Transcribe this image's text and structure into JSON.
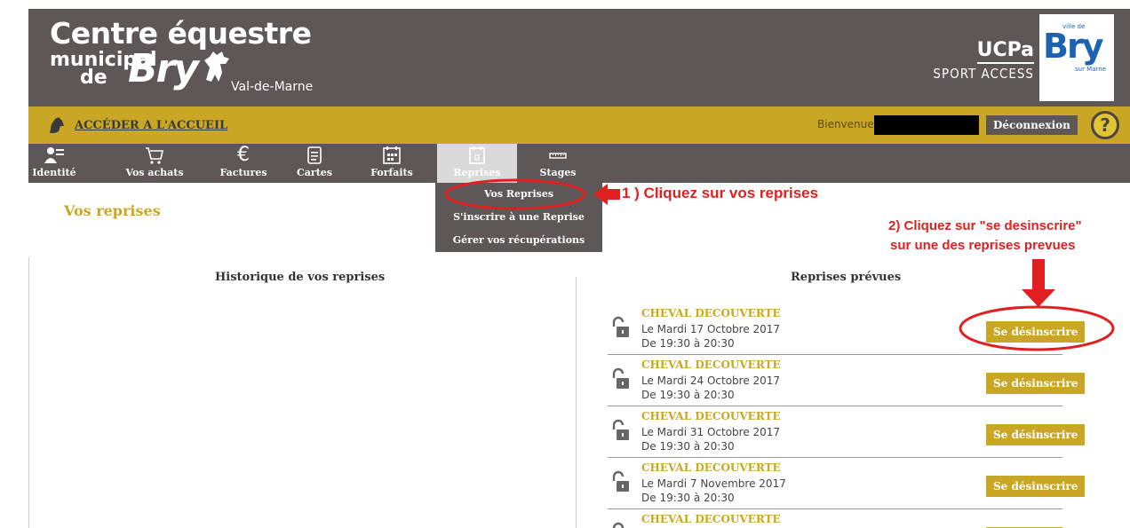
{
  "header": {
    "title": "Centre équestre",
    "subtitle_line1": "municipal",
    "subtitle_line2": "de",
    "brand": "Bry",
    "region": "Val-de-Marne",
    "partner_name": "UCPa",
    "partner_sub": "SPORT ACCESS",
    "badge": {
      "ville": "ville de",
      "name": "Bry",
      "marne": "sur Marne"
    }
  },
  "topbar": {
    "home_link": "ACCÉDER A L'ACCUEIL",
    "welcome": "Bienvenue",
    "logout": "Déconnexion",
    "help": "?"
  },
  "nav": {
    "items": [
      {
        "label": "Identité",
        "icon": "id-card-icon"
      },
      {
        "label": "Vos achats",
        "icon": "cart-icon"
      },
      {
        "label": "Factures",
        "icon": "euro-icon"
      },
      {
        "label": "Cartes",
        "icon": "card-icon"
      },
      {
        "label": "Forfaits",
        "icon": "calendar-grid-icon"
      },
      {
        "label": "Reprises",
        "icon": "calendar-icon",
        "active": true
      },
      {
        "label": "Stages",
        "icon": "ruler-icon"
      }
    ],
    "submenu": [
      "Vos Reprises",
      "S'inscrire à une Reprise",
      "Gérer vos récupérations"
    ]
  },
  "main": {
    "page_title": "Vos reprises",
    "history_title": "Historique de vos reprises",
    "upcoming_title": "Reprises prévues",
    "reprises": [
      {
        "name": "CHEVAL DECOUVERTE",
        "date": "Le Mardi 17 Octobre 2017",
        "time": "De 19:30 à 20:30",
        "action": "Se désinscrire"
      },
      {
        "name": "CHEVAL DECOUVERTE",
        "date": "Le Mardi 24 Octobre 2017",
        "time": "De 19:30 à 20:30",
        "action": "Se désinscrire"
      },
      {
        "name": "CHEVAL DECOUVERTE",
        "date": "Le Mardi 31 Octobre 2017",
        "time": "De 19:30 à 20:30",
        "action": "Se désinscrire"
      },
      {
        "name": "CHEVAL DECOUVERTE",
        "date": "Le Mardi 7 Novembre 2017",
        "time": "De 19:30 à 20:30",
        "action": "Se désinscrire"
      },
      {
        "name": "CHEVAL DECOUVERTE",
        "date": "",
        "time": "",
        "action": ""
      }
    ]
  },
  "annotations": {
    "step1": "1 ) Cliquez sur vos reprises",
    "step2_line1": "2) Cliquez sur \"se desinscrire\"",
    "step2_line2": "sur une des reprises prevues"
  },
  "colors": {
    "header_bg": "#5d5758",
    "gold": "#c9a623",
    "annotation": "#e02020"
  }
}
